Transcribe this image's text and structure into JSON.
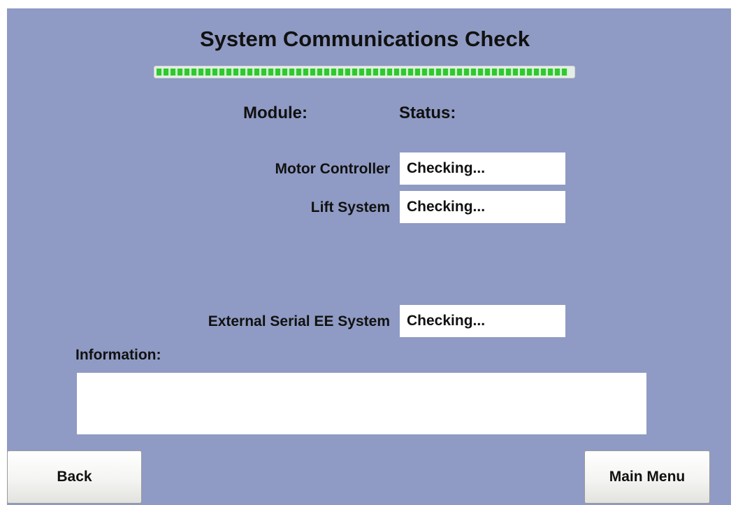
{
  "title": "System Communications Check",
  "progress": {
    "fraction": 0.99,
    "color": "#30c830"
  },
  "headers": {
    "module": "Module:",
    "status": "Status:"
  },
  "modules": [
    {
      "label": "Motor Controller",
      "status": "Checking..."
    },
    {
      "label": "Lift System",
      "status": "Checking..."
    },
    {
      "label": "External Serial EE System",
      "status": "Checking..."
    }
  ],
  "information": {
    "label": "Information:",
    "text": ""
  },
  "buttons": {
    "back": "Back",
    "main_menu": "Main Menu"
  },
  "colors": {
    "background": "#8f9bc4",
    "field": "#ffffff"
  }
}
